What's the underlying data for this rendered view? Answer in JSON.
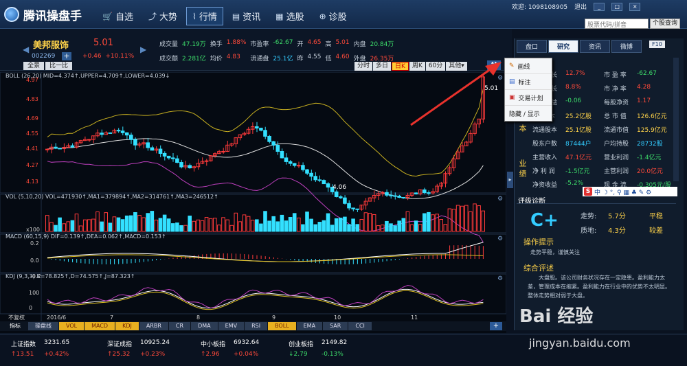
{
  "app": {
    "title": "腾讯操盘手",
    "account": "欢迎: 1098108905",
    "logout": "退出",
    "win_buttons": [
      "_",
      "□",
      "×"
    ]
  },
  "nav": [
    {
      "label": "自选",
      "icon": "cart-icon"
    },
    {
      "label": "大势",
      "icon": "trend-icon"
    },
    {
      "label": "行情",
      "icon": "chart-icon"
    },
    {
      "label": "资讯",
      "icon": "news-icon"
    },
    {
      "label": "选股",
      "icon": "select-icon"
    },
    {
      "label": "诊股",
      "icon": "diagnose-icon"
    }
  ],
  "search": {
    "placeholder": "股票代码/拼音",
    "button": "个股查询"
  },
  "stock": {
    "name": "美邦服饰",
    "price": "5.01",
    "code": "002269",
    "change": "+0.46",
    "pct": "+10.11%",
    "fields": [
      [
        "成交量",
        "47.19万",
        "换手",
        "1.88%",
        "市盈率",
        "-62.67",
        "开",
        "4.65",
        "高",
        "5.01",
        "内盘",
        "20.84万"
      ],
      [
        "成交额",
        "2.281亿",
        "均价",
        "4.83",
        "流通盘",
        "25.1亿",
        "昨",
        "4.55",
        "低",
        "4.60",
        "外盘",
        "26.35万"
      ]
    ]
  },
  "view_buttons": [
    "全景",
    "比一比"
  ],
  "periods": [
    "分时",
    "多日",
    "日K",
    "周K",
    "60分",
    "其他▾"
  ],
  "active_period": "日K",
  "panels": {
    "boll": "BOLL (26,20)  MID=4.374↑,UPPER=4.709↑,LOWER=4.039↓",
    "vol": "VOL (5,10,20)  VOL=471930↑,MA1=379894↑,MA2=314761↑,MA3=246512↑",
    "macd": "MACD (60,15,9)  DIF=0.139↑,DEA=0.062↑,MACD=0.153↑",
    "kdj": "KDJ (9,3,3)  K=78.825↑,D=74.575↑,J=87.323↑"
  },
  "price_axis": [
    "4.97",
    "4.83",
    "4.69",
    "4.55",
    "4.41",
    "4.27",
    "4.13"
  ],
  "vol_axis": "x100",
  "macd_axis": [
    "0.2",
    "0.0",
    "-0.2"
  ],
  "kdj_axis": [
    "100",
    "0"
  ],
  "dates": [
    "不复权",
    "2016/6",
    "7",
    "8",
    "9",
    "10",
    "11"
  ],
  "annot": {
    "high": "5.01",
    "low": "4.06"
  },
  "indicator_tabs": [
    "指标",
    "操盘线",
    "VOL",
    "MACD",
    "KDJ",
    "ARBR",
    "CR",
    "DMA",
    "EMV",
    "RSI",
    "BOLL",
    "EMA",
    "SAR",
    "CCI"
  ],
  "context_menu": [
    "画线",
    "标注",
    "交易计划",
    "隐藏 / 显示"
  ],
  "right_tabs": [
    "盘口",
    "研究",
    "资讯",
    "微博"
  ],
  "right_active": "研究",
  "f10": "F10",
  "fin_rows": [
    [
      "收入增长",
      "12.7%",
      "市 盈 率",
      "-62.67"
    ],
    [
      "利润增长",
      "8.8%",
      "市 净 率",
      "4.28"
    ],
    [
      "每股收益",
      "-0.06",
      "每股净资",
      "1.17"
    ],
    [
      "总 股 本",
      "25.2亿股",
      "总 市 值",
      "126.6亿元"
    ],
    [
      "流通股本",
      "25.1亿股",
      "流通市值",
      "125.9亿元"
    ],
    [
      "股东户数",
      "87444户",
      "户均持股",
      "28732股"
    ],
    [
      "主营收入",
      "47.1亿元",
      "营业利润",
      "-1.4亿元"
    ],
    [
      "净 利 润",
      "-1.5亿元",
      "主营利润",
      "20.0亿元"
    ],
    [
      "净资收益",
      "-5.2%",
      "现 金 流",
      "-0.305元/股"
    ]
  ],
  "sections": [
    "股本",
    "业绩"
  ],
  "diag": {
    "title": "评级诊断",
    "grade": "C+",
    "rows": [
      [
        "走势:",
        "5.7分",
        "平稳"
      ],
      [
        "质地:",
        "4.3分",
        "较差"
      ]
    ]
  },
  "tips": {
    "title": "操作提示",
    "text": "走势平稳，谨慎关注"
  },
  "summary": {
    "title": "综合评述",
    "text": "大盘股。该公司财务状况存在一定隐患。盈利能力太差，管理成本在缩紧。盈利能力在行业中的优势不太明显。整体走势相对弱于大盘。"
  },
  "indices": [
    [
      "上证指数",
      "3231.65",
      "↑13.51",
      "+0.42%"
    ],
    [
      "深证成指",
      "10925.24",
      "↑25.32",
      "+0.23%"
    ],
    [
      "中小板指",
      "6932.64",
      "↑2.96",
      "+0.04%"
    ],
    [
      "创业板指",
      "2149.82",
      "↓2.79",
      "-0.13%"
    ]
  ],
  "watermark": {
    "brand": "Bai 经验",
    "url": "jingyan.baidu.com"
  },
  "colors": {
    "up": "#ff4a3a",
    "down": "#3ddc6a",
    "accent": "#ffd34a",
    "cyan": "#33ccff"
  }
}
